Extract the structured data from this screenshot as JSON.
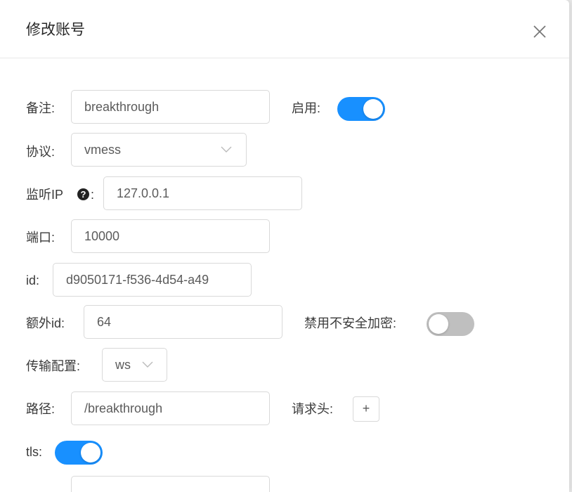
{
  "dialog": {
    "title": "修改账号",
    "close_icon": "close-icon"
  },
  "form": {
    "remark": {
      "label": "备注:",
      "value": "breakthrough"
    },
    "enable": {
      "label": "启用:",
      "checked": true
    },
    "protocol": {
      "label": "协议:",
      "value": "vmess"
    },
    "listen_ip": {
      "label": "监听IP",
      "colon": ":",
      "help_icon": "?",
      "value": "127.0.0.1"
    },
    "port": {
      "label": "端口:",
      "value": "10000"
    },
    "id": {
      "label": "id:",
      "value": "d9050171-f536-4d54-a49"
    },
    "alter_id": {
      "label": "额外id:",
      "value": "64"
    },
    "disable_insecure": {
      "label": "禁用不安全加密:",
      "checked": false
    },
    "transport": {
      "label": "传输配置:",
      "value": "ws"
    },
    "path": {
      "label": "路径:",
      "value": "/breakthrough"
    },
    "headers": {
      "label": "请求头:",
      "add_label": "+"
    },
    "tls": {
      "label": "tls:",
      "checked": true
    }
  },
  "colors": {
    "switch_on": "#1890ff",
    "switch_off": "#bfbfbf",
    "border": "#d9d9d9"
  }
}
